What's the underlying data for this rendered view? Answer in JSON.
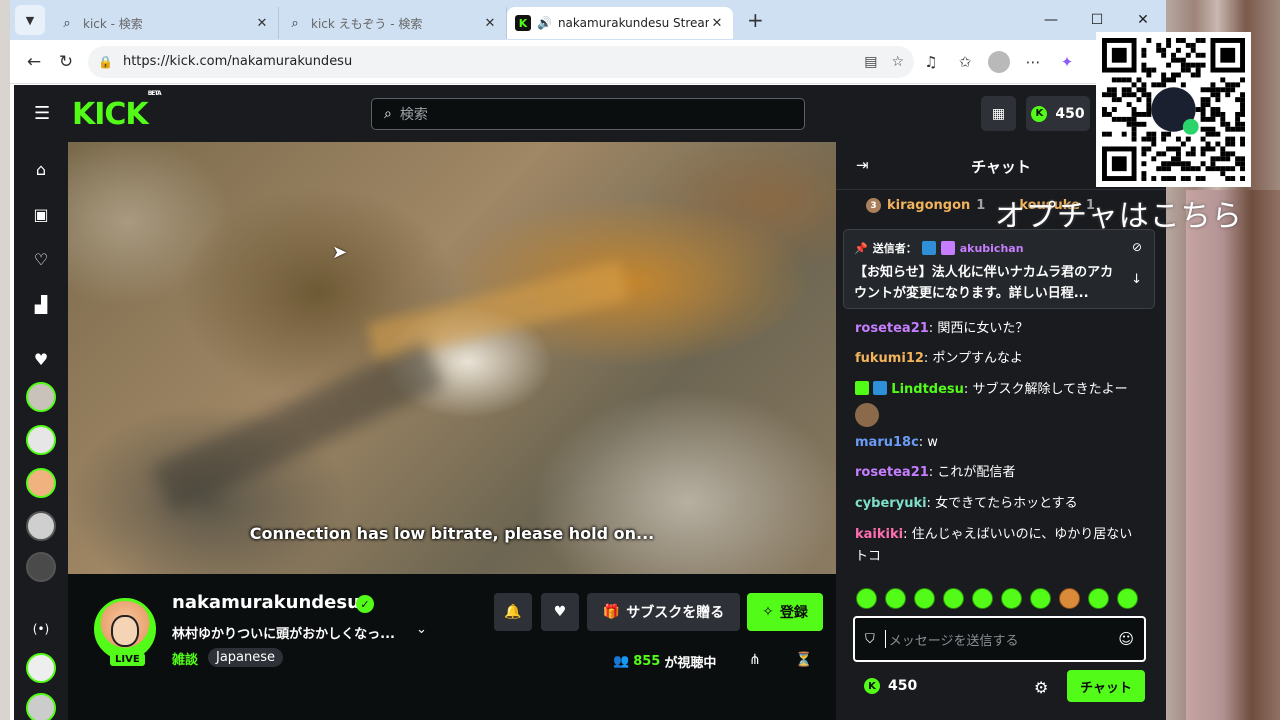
{
  "browser": {
    "tabs": [
      {
        "title": "kick - 検索",
        "icon": "search-icon"
      },
      {
        "title": "kick えもぞう - 検索",
        "icon": "search-icon"
      },
      {
        "title": "nakamurakundesu Stream - W",
        "icon": "kick-favicon"
      }
    ],
    "url": "https://kick.com/nakamurakundesu"
  },
  "kick": {
    "logo": "KICK",
    "logo_badge": "BETA",
    "search_placeholder": "検索",
    "points": "450"
  },
  "video": {
    "status_message": "Connection has low bitrate, please hold on..."
  },
  "channel": {
    "name": "nakamurakundesu",
    "live_label": "LIVE",
    "stream_title": "林村ゆかりついに頭がおかしくなっ...",
    "category": "雑談",
    "language": "Japanese",
    "gift_sub_label": "サブスクを贈る",
    "follow_label": "登録",
    "viewer_count": "855",
    "viewer_suffix": "が視聴中"
  },
  "chat": {
    "title": "チャット",
    "gifters": [
      {
        "rank": "3",
        "name": "kiragongon",
        "count": "1"
      },
      {
        "name": "kousuke",
        "count": "1"
      }
    ],
    "pinned": {
      "by_label": "送信者：",
      "sender": "akubichan",
      "text": "【お知らせ】法人化に伴いナカムラ君のアカウントが変更になります。詳しい日程..."
    },
    "messages": [
      {
        "user": "rosetea21",
        "color": "#c77dff",
        "text": "関西に女いた？"
      },
      {
        "user": "fukumi12",
        "color": "#f2b35b",
        "text": "ポンプすんなよ"
      },
      {
        "user": "Lindtdesu",
        "color": "#53fc18",
        "text": "サブスク解除してきたよー"
      },
      {
        "user": "maru18c",
        "color": "#6b9cf5",
        "text": "w"
      },
      {
        "user": "rosetea21",
        "color": "#c77dff",
        "text": "これが配信者"
      },
      {
        "user": "cyberyuki",
        "color": "#7ee0c8",
        "text": "女できてたらホッとする"
      },
      {
        "user": "kaikiki",
        "color": "#ff6fb0",
        "text": "住んじゃえばいいのに、ゆかり居ないトコ"
      }
    ],
    "input_placeholder": "メッセージを送信する",
    "points": "450",
    "send_label": "チャット"
  },
  "overlay": {
    "text": "オプチャはこちら"
  },
  "colors": {
    "kick_green": "#53fc18",
    "kick_bg": "#0b0e0f",
    "panel_bg": "#191b1f"
  }
}
